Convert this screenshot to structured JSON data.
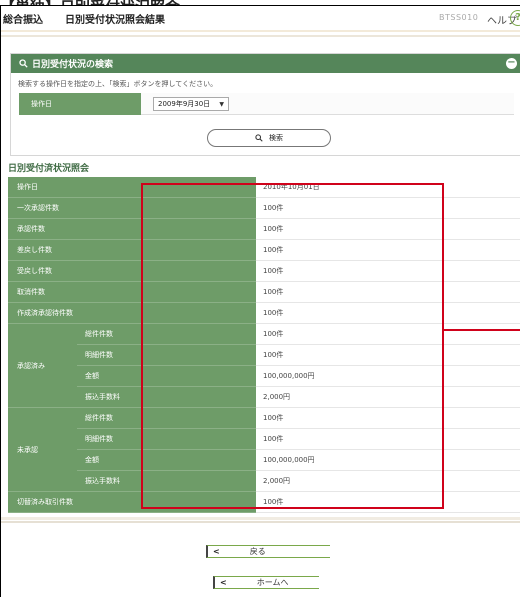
{
  "doc_heading": "【単独】日別受付状況照会",
  "header": {
    "category": "総合振込",
    "title": "日別受付状況照会結果",
    "screen_id": "BTSS010",
    "help_label": "ヘルプ",
    "help_icon": "?"
  },
  "search": {
    "title": "日別受付状況の検索",
    "search_icon": "magnifier-icon",
    "collapse_icon": "−",
    "instruction": "検索する操作日を指定の上、「検索」ボタンを押してください。",
    "date_label": "操作日",
    "date_value": "2009年9月30日",
    "date_arrow": "▼",
    "button_icon": "🔍",
    "button_label": "検索"
  },
  "result": {
    "title": "日別受付済状況照会",
    "rows": [
      {
        "label": "操作日",
        "value": "2010年10月01日"
      },
      {
        "label": "一次承認件数",
        "value": "100件"
      },
      {
        "label": "承認件数",
        "value": "100件"
      },
      {
        "label": "差戻し件数",
        "value": "100件"
      },
      {
        "label": "受戻し件数",
        "value": "100件"
      },
      {
        "label": "取消件数",
        "value": "100件"
      },
      {
        "label": "作成済承認待件数",
        "value": "100件"
      }
    ],
    "group_a": {
      "label": "承認済み",
      "rows": [
        {
          "label": "総件件数",
          "value": "100件"
        },
        {
          "label": "明細件数",
          "value": "100件"
        },
        {
          "label": "金額",
          "value": "100,000,000円"
        },
        {
          "label": "振込手数料",
          "value": "2,000円"
        }
      ]
    },
    "group_b": {
      "label": "未承認",
      "rows": [
        {
          "label": "総件件数",
          "value": "100件"
        },
        {
          "label": "明細件数",
          "value": "100件"
        },
        {
          "label": "金額",
          "value": "100,000,000円"
        },
        {
          "label": "振込手数料",
          "value": "2,000円"
        }
      ]
    },
    "last_row": {
      "label": "切替済み取引件数",
      "value": "100件"
    }
  },
  "nav": {
    "back_label": "戻る",
    "home_label": "ホームへ",
    "chevron": "<"
  },
  "colors": {
    "header_green": "#55865a",
    "label_green": "#6e9c68",
    "highlight_red": "#d0021b"
  }
}
